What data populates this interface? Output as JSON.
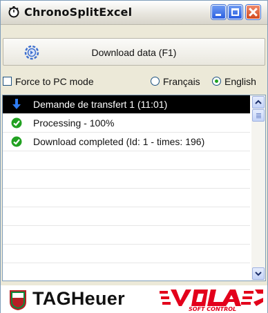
{
  "window": {
    "title": "ChronoSplitExcel",
    "icon": "stopwatch-icon"
  },
  "toolbar": {
    "download_label": "Download data (F1)",
    "download_icon": "gear-sync-icon"
  },
  "options": {
    "force_pc_label": "Force to PC mode",
    "force_pc_checked": false,
    "languages": [
      {
        "label": "Français",
        "selected": false
      },
      {
        "label": "English",
        "selected": true
      }
    ]
  },
  "log": {
    "items": [
      {
        "text": "Demande de transfert 1  (11:01)",
        "icon": "arrow-down-icon",
        "selected": true
      },
      {
        "text": "Processing - 100%",
        "icon": "check-circle-icon",
        "selected": false
      },
      {
        "text": "Download completed (Id: 1 -  times: 196)",
        "icon": "check-circle-icon",
        "selected": false
      }
    ]
  },
  "footer": {
    "brand_text": "TAGHeuer",
    "partner_logo": "VOLA SOFT CONTROL"
  },
  "colors": {
    "selected_row": "#000000",
    "check_green": "#21a121",
    "arrow_blue": "#2f7cf0",
    "vola_red": "#e3001b"
  }
}
